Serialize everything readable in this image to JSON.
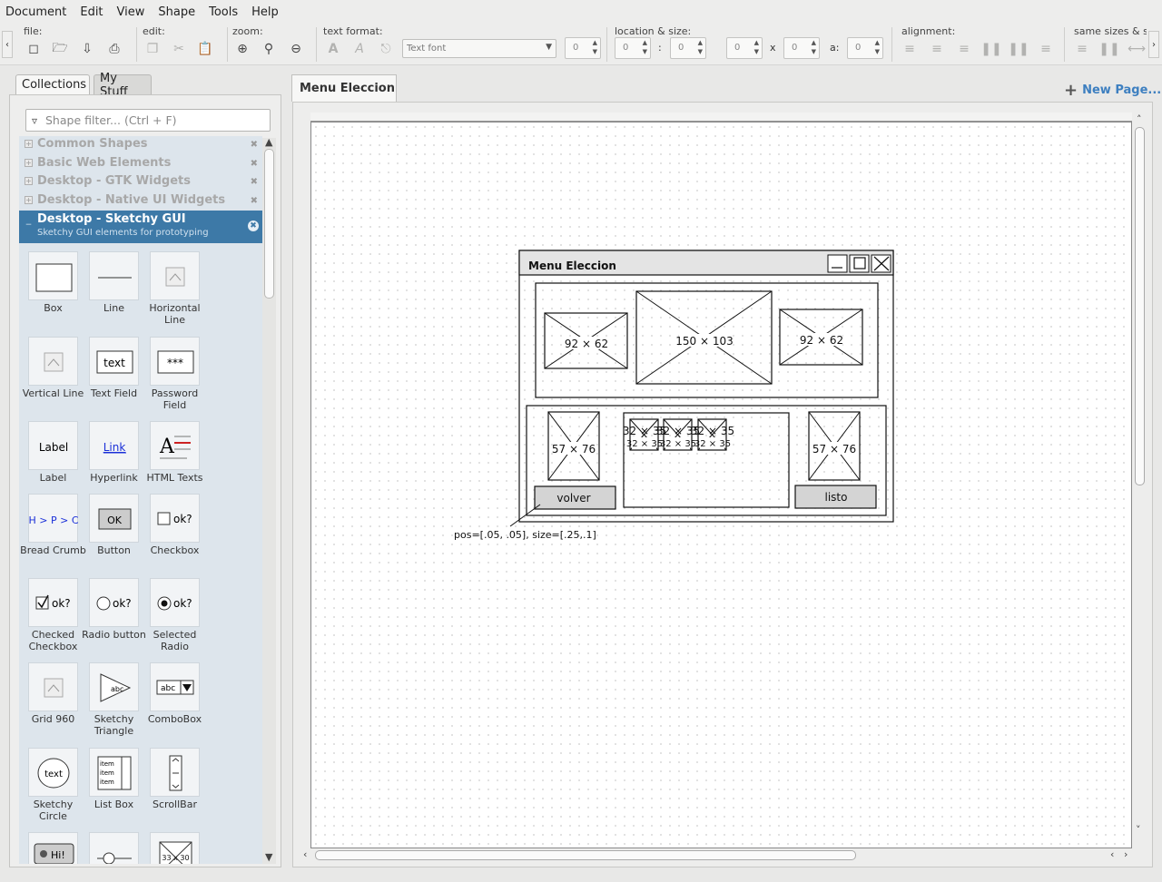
{
  "menubar": {
    "items": [
      "Document",
      "Edit",
      "View",
      "Shape",
      "Tools",
      "Help"
    ]
  },
  "toolbar": {
    "file_label": "file:",
    "edit_label": "edit:",
    "zoom_label": "zoom:",
    "text_format_label": "text format:",
    "location_size_label": "location & size:",
    "alignment_label": "alignment:",
    "same_sizes_label": "same sizes & s",
    "font_select": "Text font",
    "font_size": "0",
    "loc_x": "0",
    "loc_y": "0",
    "size_w": "0",
    "size_h": "0",
    "angle": "0",
    "colon": ":",
    "times": "x",
    "angle_label": "a:"
  },
  "left_panel": {
    "tab_collections": "Collections",
    "tab_mystuff": "My Stuff",
    "filter_placeholder": "Shape filter... (Ctrl + F)",
    "collections": [
      {
        "name": "Common Shapes"
      },
      {
        "name": "Basic Web Elements"
      },
      {
        "name": "Desktop - GTK Widgets"
      },
      {
        "name": "Desktop - Native UI Widgets"
      }
    ],
    "active_collection": {
      "name": "Desktop - Sketchy GUI",
      "subtitle": "Sketchy GUI elements for prototyping"
    },
    "shapes": [
      {
        "label": "Box",
        "icon": "box-icon"
      },
      {
        "label": "Line",
        "icon": "line-icon"
      },
      {
        "label": "Horizontal Line",
        "icon": "horizontal-line-icon"
      },
      {
        "label": "Vertical Line",
        "icon": "vertical-line-icon"
      },
      {
        "label": "Text Field",
        "icon": "text-field-icon",
        "icon_text": "text"
      },
      {
        "label": "Password Field",
        "icon": "password-field-icon",
        "icon_text": "***"
      },
      {
        "label": "Label",
        "icon": "label-icon",
        "icon_text": "Label"
      },
      {
        "label": "Hyperlink",
        "icon": "hyperlink-icon",
        "icon_text": "Link"
      },
      {
        "label": "HTML Texts",
        "icon": "html-texts-icon",
        "icon_text": "A"
      },
      {
        "label": "Bread Crumb",
        "icon": "breadcrumb-icon",
        "icon_text": "H > P > C"
      },
      {
        "label": "Button",
        "icon": "button-icon",
        "icon_text": "OK"
      },
      {
        "label": "Checkbox",
        "icon": "checkbox-icon",
        "icon_text": "ok?"
      },
      {
        "label": "Checked Checkbox",
        "icon": "checked-checkbox-icon",
        "icon_text": "ok?"
      },
      {
        "label": "Radio button",
        "icon": "radio-button-icon",
        "icon_text": "ok?"
      },
      {
        "label": "Selected Radio",
        "icon": "selected-radio-icon",
        "icon_text": "ok?"
      },
      {
        "label": "Grid 960",
        "icon": "grid-960-icon"
      },
      {
        "label": "Sketchy Triangle",
        "icon": "sketchy-triangle-icon",
        "icon_text": "abc"
      },
      {
        "label": "ComboBox",
        "icon": "combobox-icon",
        "icon_text": "abc"
      },
      {
        "label": "Sketchy Circle",
        "icon": "sketchy-circle-icon",
        "icon_text": "text"
      },
      {
        "label": "List Box",
        "icon": "list-box-icon",
        "icon_text": "item"
      },
      {
        "label": "ScrollBar",
        "icon": "scrollbar-icon"
      },
      {
        "label": "",
        "icon": "hi-bubble-icon",
        "icon_text": "Hi!"
      },
      {
        "label": "",
        "icon": "slider-icon"
      },
      {
        "label": "",
        "icon": "image-placeholder-icon",
        "icon_text": "33 x 30"
      }
    ]
  },
  "page": {
    "tab_title": "Menu Eleccion",
    "new_page": "New Page..."
  },
  "sketch": {
    "window_title": "Menu Eleccion",
    "img_top_left": "92 × 62",
    "img_top_center": "150 × 103",
    "img_top_right": "92 × 62",
    "img_left": "57 × 76",
    "img_right": "57 × 76",
    "thumbs": [
      "32 × 35",
      "32 × 35",
      "32 × 35"
    ],
    "btn_back": "volver",
    "btn_ready": "listo",
    "annotation": "pos=[.05, .05], size=[.25,.1]"
  }
}
